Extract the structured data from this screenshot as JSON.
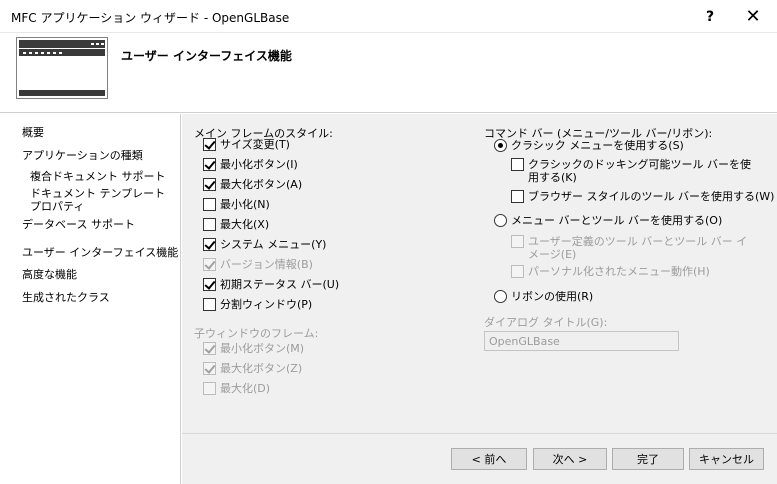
{
  "window": {
    "title": "MFC アプリケーション ウィザード - OpenGLBase",
    "help_glyph": "?",
    "close_glyph": "✕"
  },
  "header": {
    "heading": "ユーザー インターフェイス機能",
    "icon": "wizard-window-icon"
  },
  "nav": {
    "items": [
      {
        "label": "概要"
      },
      {
        "label": "アプリケーションの種類"
      },
      {
        "label": "複合ドキュメント サポート"
      },
      {
        "label": "ドキュメント テンプレート プロパティ"
      },
      {
        "label": "データベース サポート"
      },
      {
        "label": "ユーザー インターフェイス機能"
      },
      {
        "label": "高度な機能"
      },
      {
        "label": "生成されたクラス"
      }
    ]
  },
  "main_frame": {
    "label": "メイン フレームのスタイル:",
    "options": [
      {
        "label": "サイズ変更(T)",
        "checked": true,
        "enabled": true
      },
      {
        "label": "最小化ボタン(I)",
        "checked": true,
        "enabled": true
      },
      {
        "label": "最大化ボタン(A)",
        "checked": true,
        "enabled": true
      },
      {
        "label": "最小化(N)",
        "checked": false,
        "enabled": true
      },
      {
        "label": "最大化(X)",
        "checked": false,
        "enabled": true
      },
      {
        "label": "システム メニュー(Y)",
        "checked": true,
        "enabled": true
      },
      {
        "label": "バージョン情報(B)",
        "checked": true,
        "enabled": false
      },
      {
        "label": "初期ステータス バー(U)",
        "checked": true,
        "enabled": true
      },
      {
        "label": "分割ウィンドウ(P)",
        "checked": false,
        "enabled": true
      }
    ]
  },
  "child_frame": {
    "label": "子ウィンドウのフレーム:",
    "options": [
      {
        "label": "最小化ボタン(M)",
        "checked": true,
        "enabled": false
      },
      {
        "label": "最大化ボタン(Z)",
        "checked": true,
        "enabled": false
      },
      {
        "label": "最大化(D)",
        "checked": false,
        "enabled": false
      }
    ]
  },
  "command_bar": {
    "label": "コマンド バー (メニュー/ツール バー/リボン):",
    "classic_menu": {
      "label": "クラシック メニューを使用する(S)",
      "selected": true
    },
    "docking_toolbar": {
      "label": "クラシックのドッキング可能ツール バーを使用する(K)",
      "checked": false
    },
    "browser_toolbar": {
      "label": "ブラウザー スタイルのツール バーを使用する(W)",
      "checked": false
    },
    "menu_toolbar": {
      "label": "メニュー バーとツール バーを使用する(O)",
      "selected": false
    },
    "user_defined": {
      "label": "ユーザー定義のツール バーとツール バー イメージ(E)",
      "checked": false
    },
    "personalized": {
      "label": "パーソナル化されたメニュー動作(H)",
      "checked": false
    },
    "ribbon": {
      "label": "リボンの使用(R)",
      "selected": false
    }
  },
  "dialog_title": {
    "label": "ダイアログ タイトル(G):",
    "value": "OpenGLBase"
  },
  "buttons": {
    "back": "< 前へ",
    "next": "次へ >",
    "finish": "完了",
    "cancel": "キャンセル"
  }
}
